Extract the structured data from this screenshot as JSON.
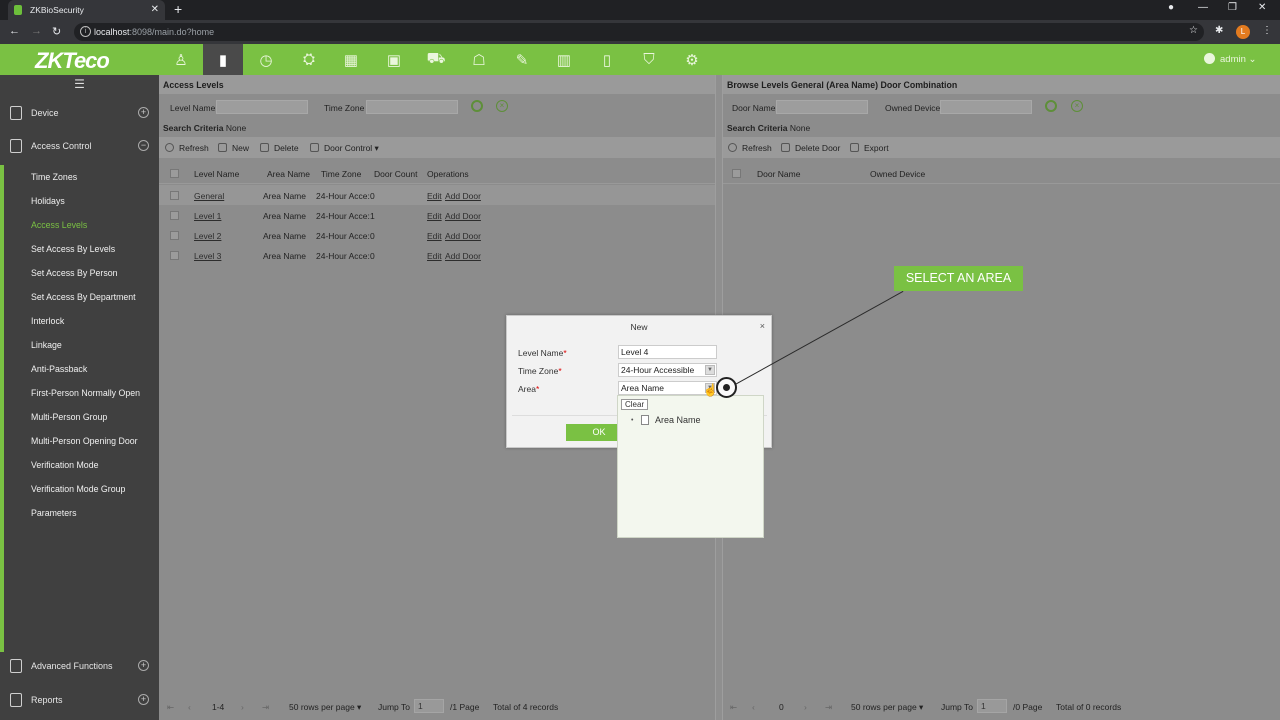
{
  "browser": {
    "tab_title": "ZKBioSecurity",
    "url_host": "localhost",
    "url_path": ":8098/main.do?home",
    "profile_initial": "L"
  },
  "header": {
    "logo": "ZKTeco",
    "user": "admin",
    "modules": [
      "person-icon",
      "door-icon",
      "clock-icon",
      "elevator-icon",
      "visitor-icon",
      "parking-icon",
      "patrol-icon",
      "vms-icon",
      "building-icon",
      "consumption-icon",
      "shield-icon",
      "gear-icon"
    ]
  },
  "sidebar": {
    "groups": [
      {
        "label": "Device",
        "expander": "+"
      },
      {
        "label": "Access Control",
        "expander": "−"
      },
      {
        "label": "Advanced Functions",
        "expander": "+"
      },
      {
        "label": "Reports",
        "expander": "+"
      }
    ],
    "items": [
      {
        "label": "Time Zones"
      },
      {
        "label": "Holidays"
      },
      {
        "label": "Access Levels"
      },
      {
        "label": "Set Access By Levels"
      },
      {
        "label": "Set Access By Person"
      },
      {
        "label": "Set Access By Department"
      },
      {
        "label": "Interlock"
      },
      {
        "label": "Linkage"
      },
      {
        "label": "Anti-Passback"
      },
      {
        "label": "First-Person Normally Open"
      },
      {
        "label": "Multi-Person Group"
      },
      {
        "label": "Multi-Person Opening Door"
      },
      {
        "label": "Verification Mode"
      },
      {
        "label": "Verification Mode Group"
      },
      {
        "label": "Parameters"
      }
    ]
  },
  "left": {
    "title": "Access Levels",
    "filter": {
      "level_name": "Level Name",
      "time_zone": "Time Zone"
    },
    "criteria_label": "Search Criteria",
    "criteria_value": "None",
    "toolbar": {
      "refresh": "Refresh",
      "new": "New",
      "delete": "Delete",
      "door_control": "Door Control"
    },
    "columns": [
      "Level Name",
      "Area Name",
      "Time Zone",
      "Door Count",
      "Operations"
    ],
    "rows": [
      {
        "name": "General",
        "area": "Area Name",
        "tz": "24-Hour Acce:",
        "count": "0",
        "edit": "Edit",
        "add": "Add Door"
      },
      {
        "name": "Level 1",
        "area": "Area Name",
        "tz": "24-Hour Acce:",
        "count": "1",
        "edit": "Edit",
        "add": "Add Door"
      },
      {
        "name": "Level 2",
        "area": "Area Name",
        "tz": "24-Hour Acce:",
        "count": "0",
        "edit": "Edit",
        "add": "Add Door"
      },
      {
        "name": "Level 3",
        "area": "Area Name",
        "tz": "24-Hour Acce:",
        "count": "0",
        "edit": "Edit",
        "add": "Add Door"
      }
    ],
    "pager": {
      "range": "1-4",
      "per_page": "50 rows per page",
      "jump_to": "Jump To",
      "page": "1",
      "total_pages": "/1 Page",
      "total": "Total of 4 records"
    }
  },
  "right": {
    "title": "Browse Levels General  (Area Name)  Door Combination",
    "filter": {
      "door_name": "Door Name",
      "owned_device": "Owned Device"
    },
    "criteria_label": "Search Criteria",
    "criteria_value": "None",
    "toolbar": {
      "refresh": "Refresh",
      "delete_door": "Delete Door",
      "export": "Export"
    },
    "columns": [
      "Door Name",
      "Owned Device"
    ],
    "pager": {
      "range": "0",
      "per_page": "50 rows per page",
      "jump_to": "Jump To",
      "page": "1",
      "total_pages": "/0 Page",
      "total": "Total of 0 records"
    }
  },
  "dialog": {
    "title": "New",
    "close": "×",
    "level_name_label": "Level Name",
    "level_name_value": "Level 4",
    "time_zone_label": "Time Zone",
    "time_zone_value": "24-Hour Accessible",
    "area_label": "Area",
    "area_value": "Area Name",
    "required_mark": "*",
    "ok": "OK",
    "dropdown": {
      "clear": "Clear",
      "node": "Area Name"
    }
  },
  "callout": {
    "text": "SELECT AN AREA"
  },
  "colors": {
    "brand_green": "#7ac143",
    "sidebar": "#404040",
    "overlay": "#8c8c8c"
  }
}
